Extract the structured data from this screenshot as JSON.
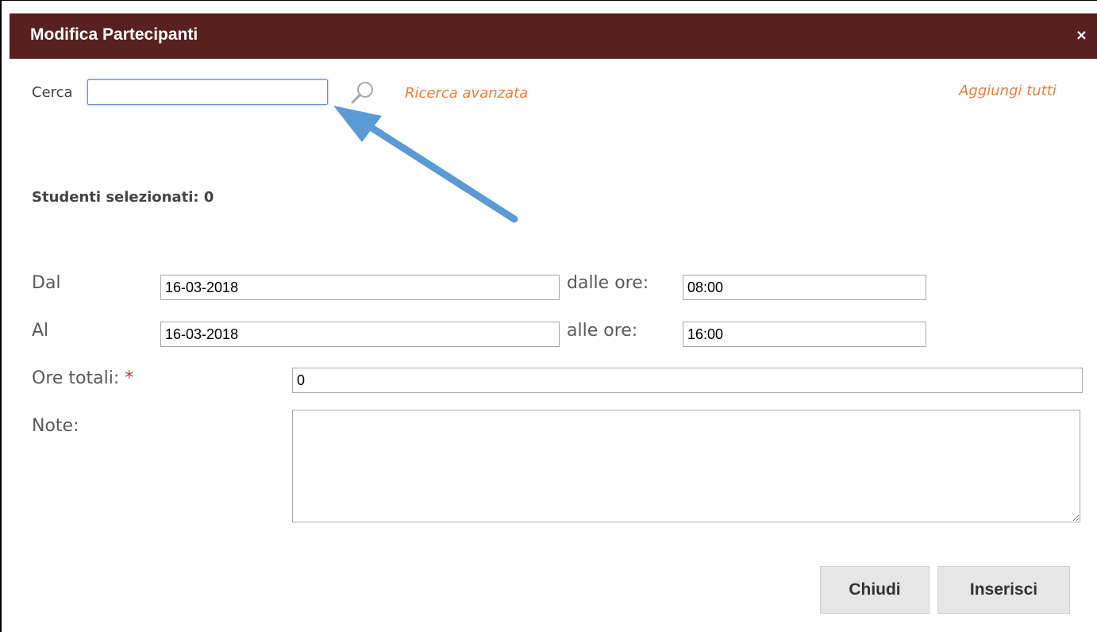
{
  "dialog": {
    "title": "Modifica Partecipanti",
    "close_glyph": "×"
  },
  "search": {
    "label": "Cerca",
    "value": "",
    "icon": "search-icon",
    "advanced_link": "Ricerca avanzata",
    "add_all_link": "Aggiungi tutti"
  },
  "selection": {
    "text": "Studenti selezionati: 0"
  },
  "form": {
    "from_label": "Dal",
    "from_date": "16-03-2018",
    "from_time_label": "dalle ore:",
    "from_time": "08:00",
    "to_label": "Al",
    "to_date": "16-03-2018",
    "to_time_label": "alle ore:",
    "to_time": "16:00",
    "total_hours_label": "Ore totali:",
    "required_mark": "*",
    "total_hours": "0",
    "notes_label": "Note:",
    "notes": ""
  },
  "buttons": {
    "close": "Chiudi",
    "insert": "Inserisci"
  },
  "colors": {
    "titlebar": "#58201e",
    "link": "#f07d3a",
    "annotation_arrow": "#5b9bd5"
  }
}
